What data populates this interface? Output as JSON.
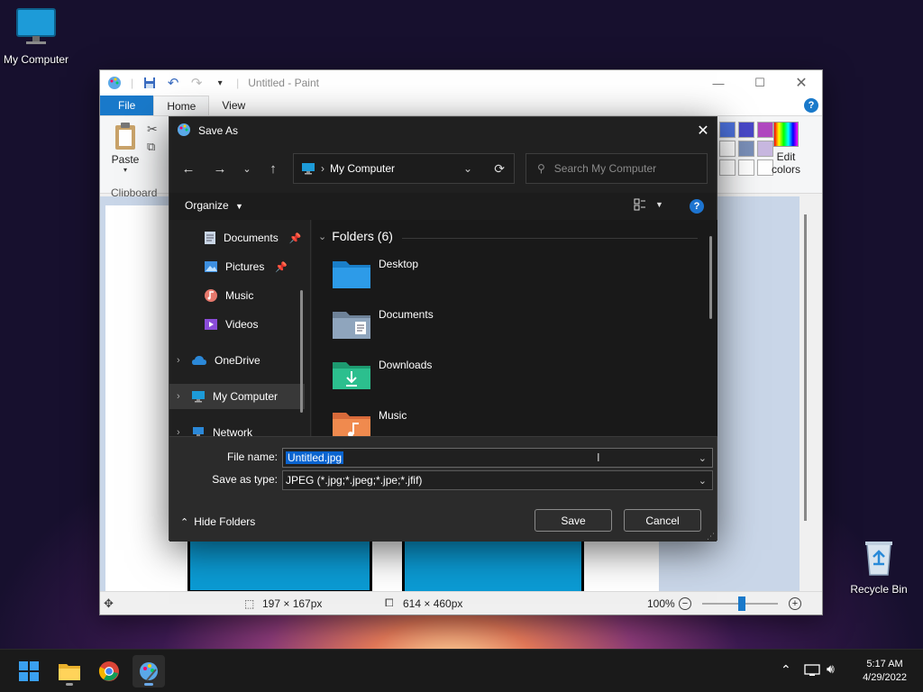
{
  "desktop": {
    "my_computer_label": "My Computer",
    "recycle_bin_label": "Recycle Bin"
  },
  "paint": {
    "title": "Untitled - Paint",
    "tabs": [
      "File",
      "Home",
      "View"
    ],
    "ribbon": {
      "paste_label": "Paste",
      "clipboard_group": "Clipboard",
      "edit_colors_line1": "Edit",
      "edit_colors_line2": "colors"
    },
    "palette_colors": [
      "#4b6fd8",
      "#4848c8",
      "#b048c0",
      "#ffffff",
      "#7a8fb8",
      "#c8b8e0",
      "#ffffff",
      "#ffffff",
      "#ffffff"
    ],
    "status": {
      "selection_size": "197 × 167px",
      "image_size": "614 × 460px",
      "zoom": "100%"
    },
    "zoom_level": 0.52
  },
  "dialog": {
    "title": "Save As",
    "address": "My Computer",
    "search_placeholder": "Search My Computer",
    "organize_label": "Organize",
    "nav_items": [
      {
        "label": "Documents",
        "icon": "documents-icon",
        "pinned": true
      },
      {
        "label": "Pictures",
        "icon": "pictures-icon",
        "pinned": true
      },
      {
        "label": "Music",
        "icon": "music-icon",
        "pinned": false
      },
      {
        "label": "Videos",
        "icon": "videos-icon",
        "pinned": false
      },
      {
        "label": "OneDrive",
        "icon": "onedrive-icon",
        "pinned": false
      },
      {
        "label": "My Computer",
        "icon": "computer-icon",
        "pinned": false
      },
      {
        "label": "Network",
        "icon": "network-icon",
        "pinned": false
      }
    ],
    "folders_header": "Folders (6)",
    "folders": [
      {
        "label": "Desktop",
        "color": "#2d9be8"
      },
      {
        "label": "Documents",
        "color": "#8fa5bd"
      },
      {
        "label": "Downloads",
        "color": "#2cbf8e"
      },
      {
        "label": "Music",
        "color": "#f08a4e"
      }
    ],
    "file_name_label": "File name:",
    "file_name_value": "Untitled.jpg",
    "save_type_label": "Save as type:",
    "save_type_value": "JPEG (*.jpg;*.jpeg;*.jpe;*.jfif)",
    "hide_folders_label": "Hide Folders",
    "save_label": "Save",
    "cancel_label": "Cancel"
  },
  "taskbar": {
    "time": "5:17 AM",
    "date": "4/29/2022",
    "apps": [
      "start-icon",
      "file-explorer-icon",
      "chrome-icon",
      "paint-icon"
    ]
  }
}
